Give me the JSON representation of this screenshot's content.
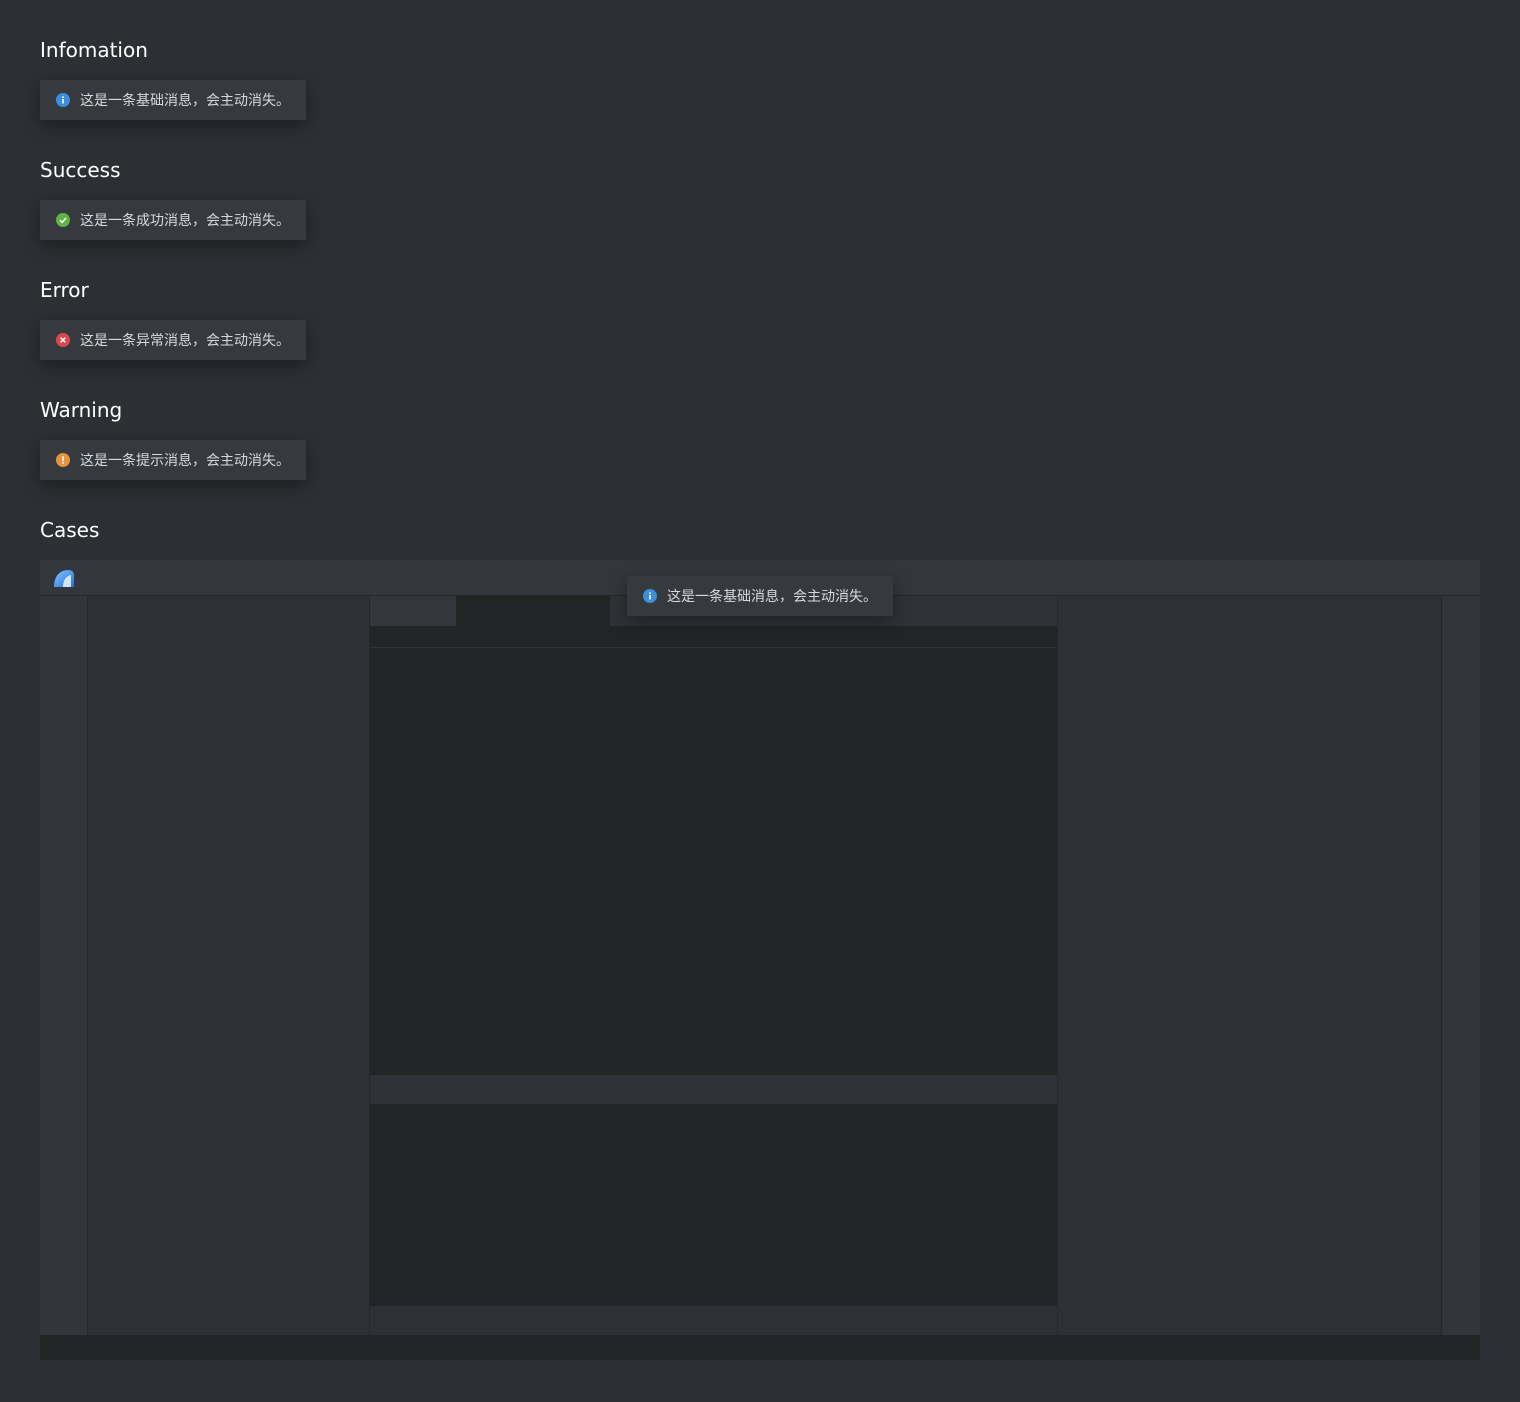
{
  "sections": {
    "info": {
      "title": "Infomation",
      "message": "这是一条基础消息，会主动消失。"
    },
    "success": {
      "title": "Success",
      "message": "这是一条成功消息，会主动消失。"
    },
    "error": {
      "title": "Error",
      "message": "这是一条异常消息，会主动消失。"
    },
    "warning": {
      "title": "Warning",
      "message": "这是一条提示消息，会主动消失。"
    },
    "cases": {
      "title": "Cases",
      "toast_message": "这是一条基础消息，会主动消失。"
    }
  },
  "colors": {
    "background": "#2c2f33",
    "toast_background": "#363a3f",
    "info": "#3d8fd9",
    "success": "#5eb342",
    "error": "#d9474b",
    "warning": "#e4943a"
  },
  "icons": {
    "info": "info-icon",
    "success": "check-circle-icon",
    "error": "x-circle-icon",
    "warning": "exclamation-circle-icon",
    "logo": "app-logo-icon"
  }
}
